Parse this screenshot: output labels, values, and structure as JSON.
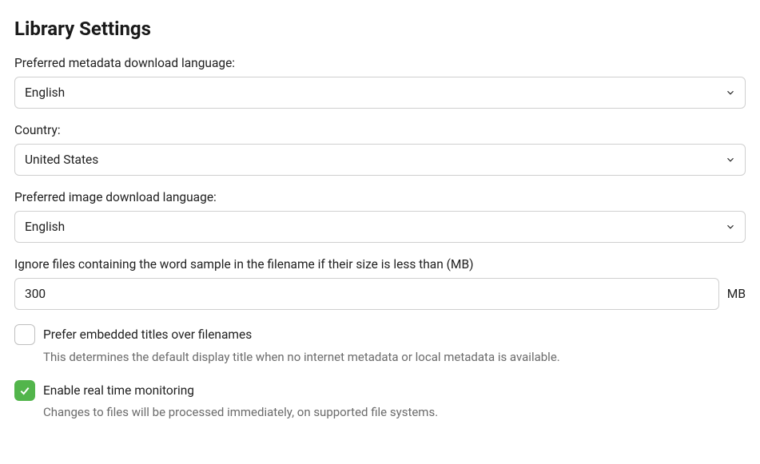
{
  "title": "Library Settings",
  "fields": {
    "metadata_language": {
      "label": "Preferred metadata download language:",
      "value": "English"
    },
    "country": {
      "label": "Country:",
      "value": "United States"
    },
    "image_language": {
      "label": "Preferred image download language:",
      "value": "English"
    },
    "ignore_sample": {
      "label": "Ignore files containing the word sample in the filename if their size is less than (MB)",
      "value": "300",
      "unit": "MB"
    }
  },
  "checkboxes": {
    "prefer_embedded": {
      "label": "Prefer embedded titles over filenames",
      "description": "This determines the default display title when no internet metadata or local metadata is available.",
      "checked": false
    },
    "realtime_monitoring": {
      "label": "Enable real time monitoring",
      "description": "Changes to files will be processed immediately, on supported file systems.",
      "checked": true
    }
  }
}
